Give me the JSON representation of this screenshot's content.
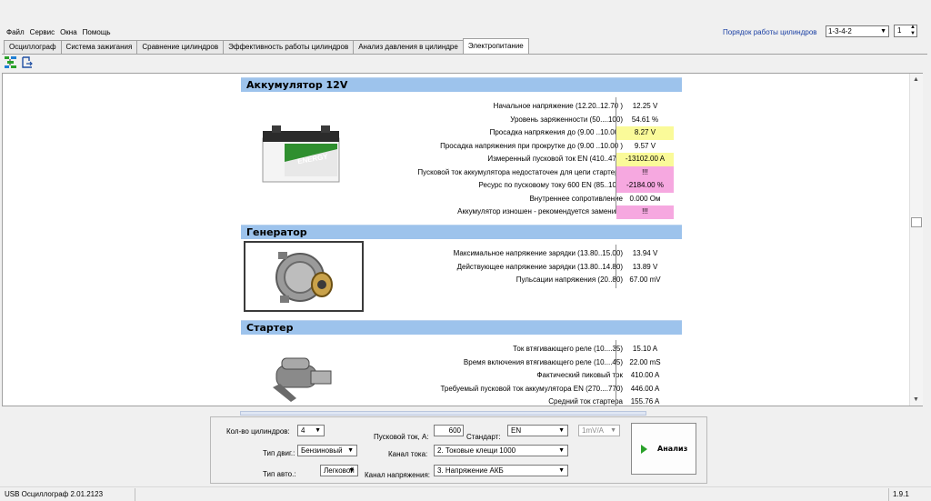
{
  "menu": [
    "Файл",
    "Сервис",
    "Окна",
    "Помощь"
  ],
  "order": {
    "label": "Порядок работы цилиндров",
    "value": "1-3-4-2",
    "spin_value": "1"
  },
  "tabs": [
    "Осциллограф",
    "Система зажигания",
    "Сравнение цилиндров",
    "Эффективность работы цилиндров",
    "Анализ давления в цилиндре",
    "Электропитание"
  ],
  "active_tab": "Электропитание",
  "toolbar_icons": [
    "tree-icon",
    "export-icon"
  ],
  "battery": {
    "title": "Аккумулятор 12V",
    "brand": "ENERGY",
    "rows": [
      {
        "label": "Начальное напряжение (12.20..12.70 )",
        "value": "12.25 V",
        "hl": ""
      },
      {
        "label": "Уровень заряженности (50....100)",
        "value": "54.61 %",
        "hl": ""
      },
      {
        "label": "Просадка напряжения до (9.00 ..10.00 )",
        "value": "8.27 V",
        "hl": "yellow"
      },
      {
        "label": "Просадка напряжения при прокрутке до (9.00 ..10.00 )",
        "value": "9.57 V",
        "hl": ""
      },
      {
        "label": "Измеренный пусковой ток  EN (410..470)",
        "value": "-13102.00 A",
        "hl": "yellow"
      },
      {
        "label": "Пусковой ток аккумулятора недостаточен для цепи стартера",
        "value": "!!!",
        "hl": "pink"
      },
      {
        "label": "Ресурс по пусковому току  600 EN (85..105)",
        "value": "-2184.00 %",
        "hl": "pink"
      },
      {
        "label": "Внутреннее сопротивление",
        "value": "0.000 Ом",
        "hl": ""
      },
      {
        "label": "Аккумулятор изношен - рекомендуется заменить",
        "value": "!!!",
        "hl": "pink"
      }
    ]
  },
  "generator": {
    "title": "Генератор",
    "rows": [
      {
        "label": "Максимальное напряжение зарядки  (13.80..15.00)",
        "value": "13.94 V",
        "hl": ""
      },
      {
        "label": "Действующее напряжение зарядки (13.80..14.80)",
        "value": "13.89 V",
        "hl": ""
      },
      {
        "label": "Пульсации напряжения (20..80)",
        "value": "67.00 mV",
        "hl": ""
      }
    ]
  },
  "starter": {
    "title": "Стартер",
    "rows": [
      {
        "label": "Ток втягивающего реле (10....35)",
        "value": "15.10 A",
        "hl": ""
      },
      {
        "label": "Время включения втягивающего реле (10....45)",
        "value": "22.00 mS",
        "hl": ""
      },
      {
        "label": "Фактический пиковый ток",
        "value": "410.00 A",
        "hl": ""
      },
      {
        "label": "Требуемый пусковой ток аккумулятора  EN (270....770)",
        "value": "446.00 A",
        "hl": ""
      },
      {
        "label": "Средний ток стартера",
        "value": "155.76 A",
        "hl": ""
      }
    ]
  },
  "controls": {
    "cylinders_label": "Кол-во цилиндров:",
    "cylinders_value": "4",
    "engine_label": "Тип двиг.:",
    "engine_value": "Бензиновый",
    "car_label": "Тип авто.:",
    "car_value": "Легковой",
    "start_current_label": "Пусковой ток, А:",
    "start_current_value": "600",
    "standard_label": "Стандарт:",
    "standard_value": "EN",
    "scale_value": "1mV/A",
    "current_channel_label": "Канал тока:",
    "current_channel_value": "2. Токовые клещи 1000",
    "voltage_channel_label": "Канал напряжения:",
    "voltage_channel_value": "3. Напряжение АКБ",
    "analyze_label": "Анализ"
  },
  "status": {
    "left": "USB Осциллограф  2.01.2123",
    "right": "1.9.1"
  }
}
